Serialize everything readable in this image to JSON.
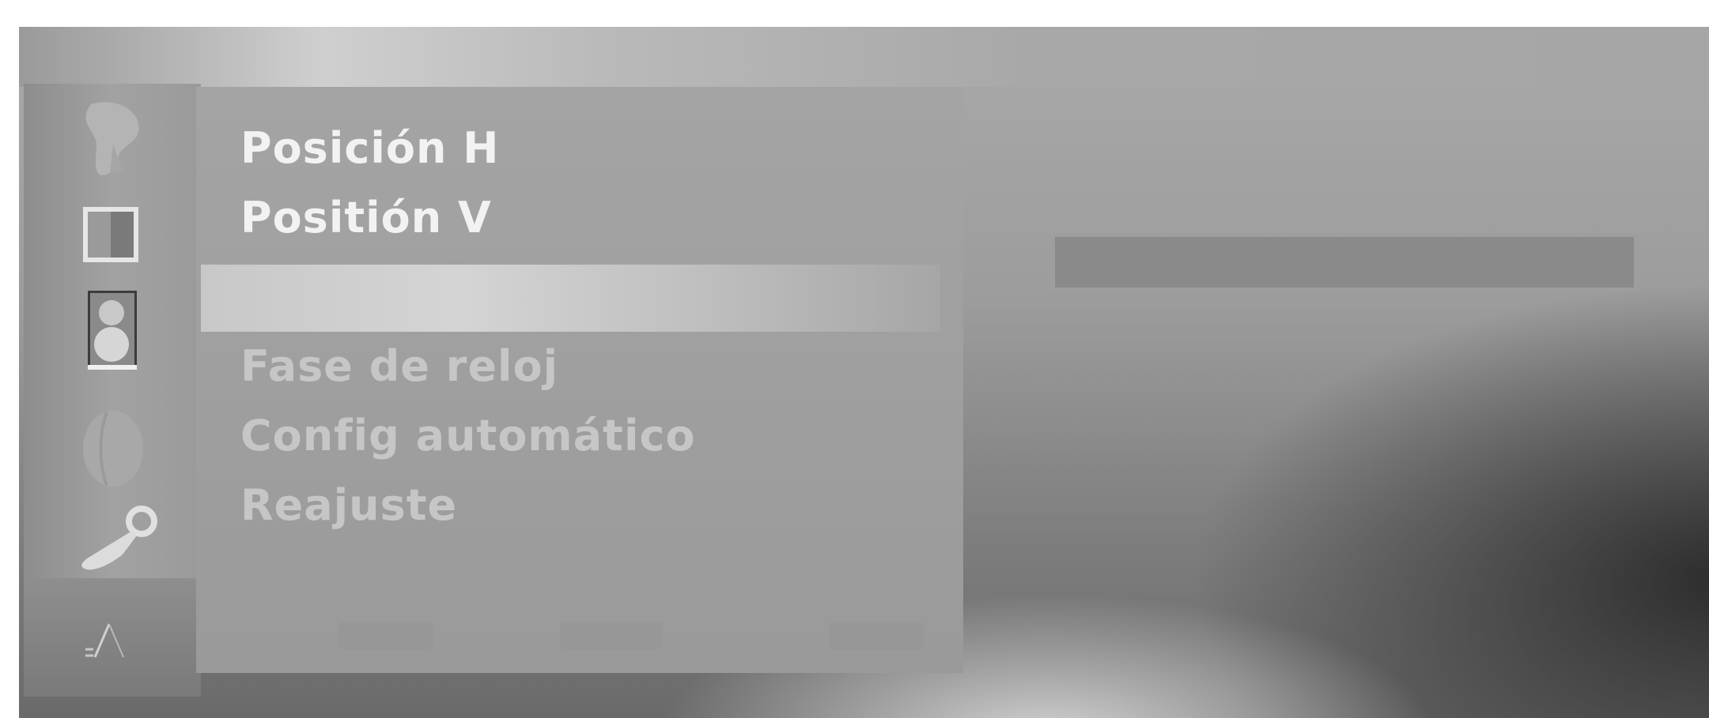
{
  "menu": {
    "items": [
      {
        "label": "Posición H",
        "state": "enabled"
      },
      {
        "label": "Positión V",
        "state": "enabled"
      },
      {
        "label": "",
        "state": "selected"
      },
      {
        "label": "Fase de reloj",
        "state": "disabled"
      },
      {
        "label": "Config automático",
        "state": "disabled"
      },
      {
        "label": "Reajuste",
        "state": "disabled"
      }
    ]
  },
  "sidebar": {
    "icons": [
      "satellite-dish-icon",
      "picture-icon",
      "speaker-icon",
      "globe-icon",
      "wrench-icon"
    ],
    "footer_icon": "tools-icon"
  },
  "slider": {
    "level": 0.0
  },
  "colors": {
    "panel": "#9e9e9e",
    "highlight": "#cccccc",
    "enabled_text": "#f2f2f2",
    "disabled_text": "#c6c6c6"
  }
}
